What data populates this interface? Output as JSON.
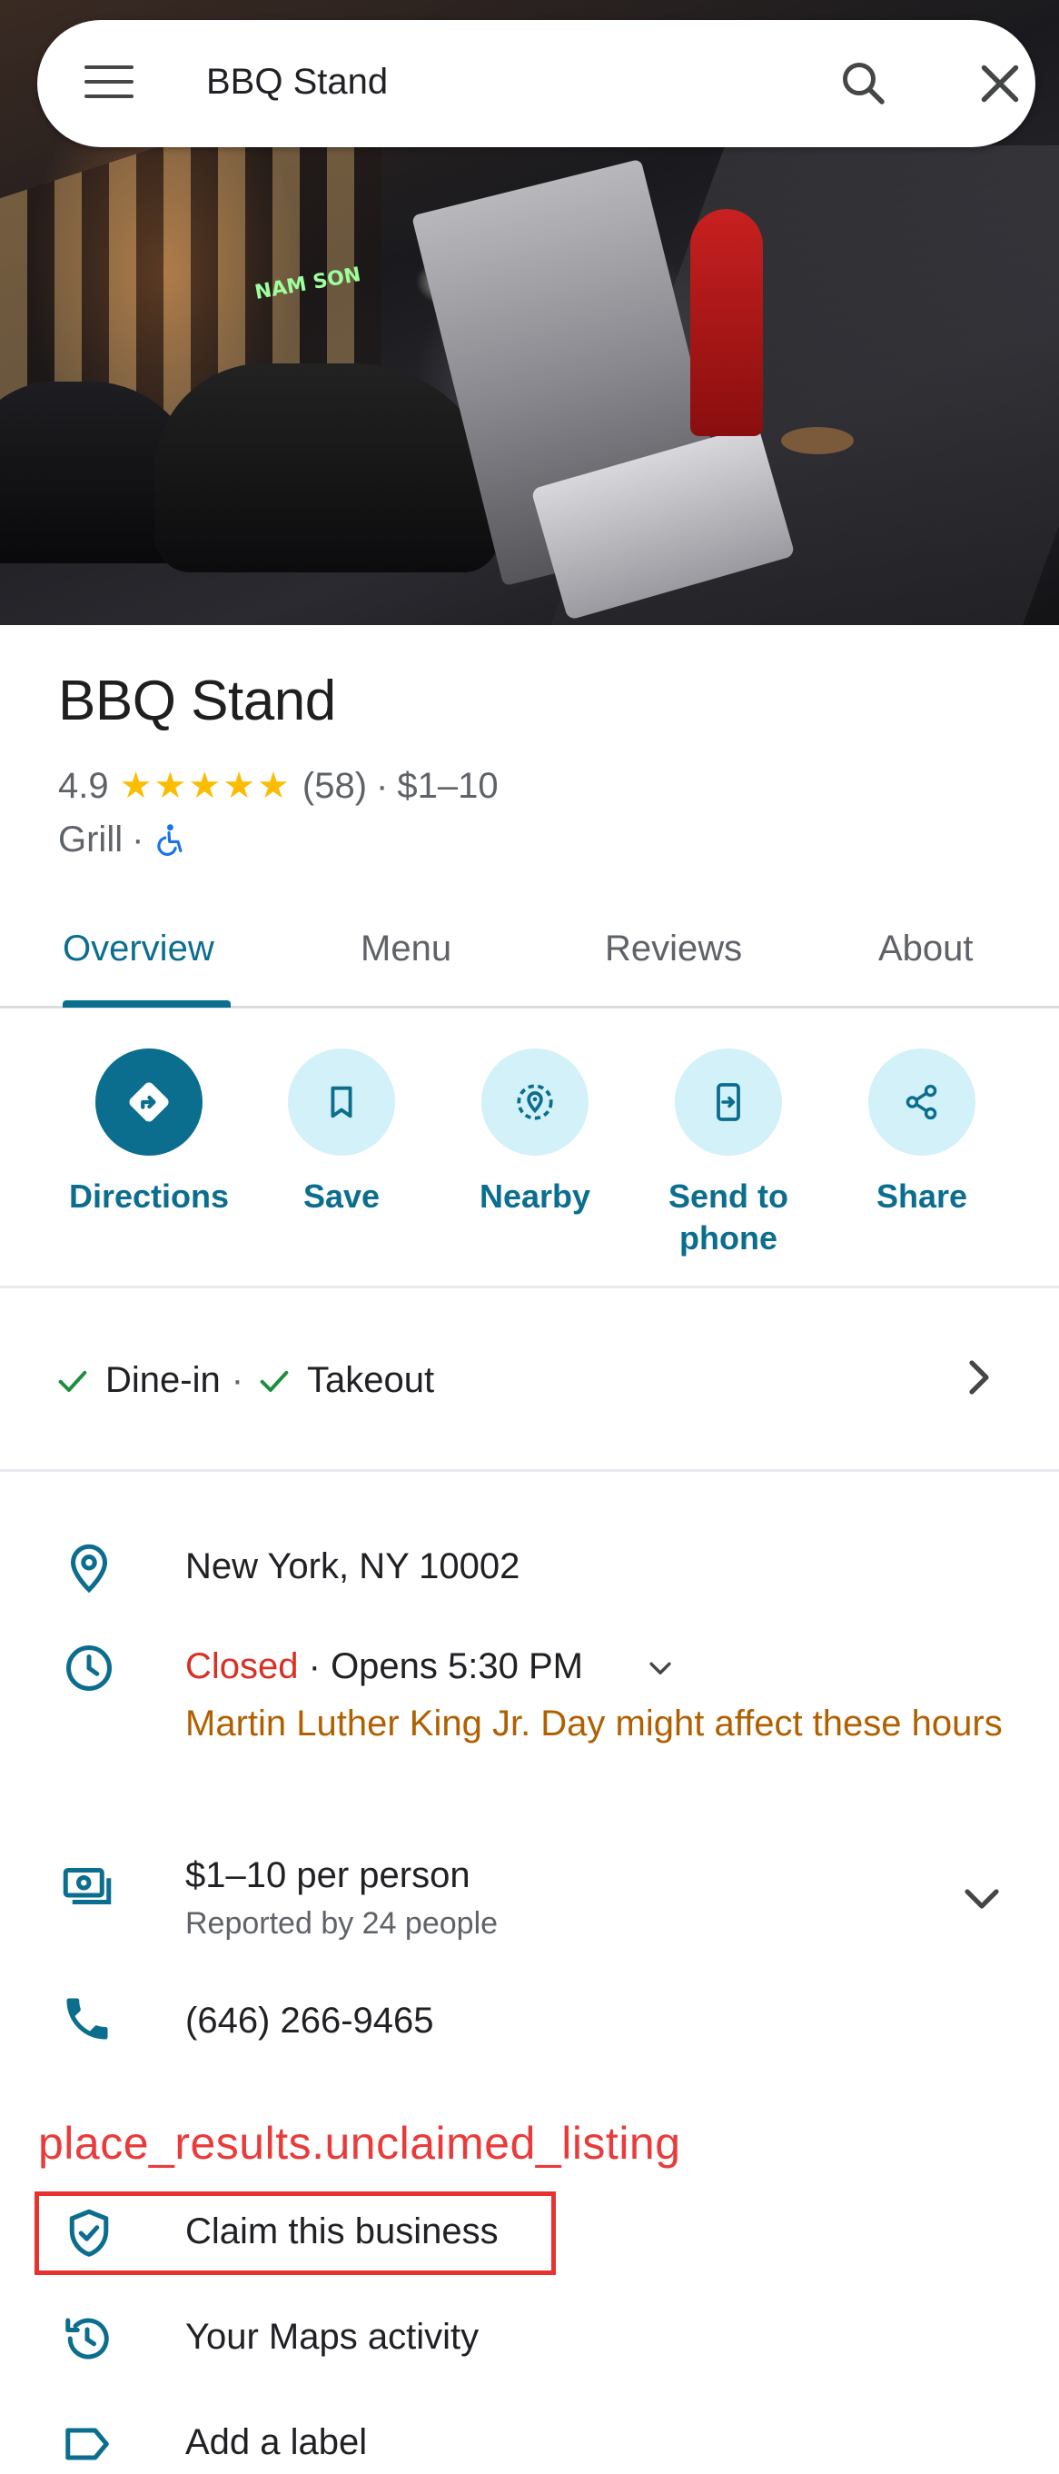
{
  "search": {
    "query": "BBQ Stand"
  },
  "hero": {
    "sign_text": "NAM SON"
  },
  "place": {
    "name": "BBQ Stand",
    "rating": "4.9",
    "stars": "★★★★★",
    "review_count": "(58)",
    "separator": "·",
    "price": "$1–10",
    "category": "Grill",
    "category_sep": "·"
  },
  "tabs": [
    {
      "label": "Overview",
      "active": true
    },
    {
      "label": "Menu",
      "active": false
    },
    {
      "label": "Reviews",
      "active": false
    },
    {
      "label": "About",
      "active": false
    }
  ],
  "actions": [
    {
      "label": "Directions",
      "icon": "directions-icon"
    },
    {
      "label": "Save",
      "icon": "bookmark-icon"
    },
    {
      "label": "Nearby",
      "icon": "nearby-icon"
    },
    {
      "label": "Send to\nphone",
      "line1": "Send to",
      "line2": "phone",
      "icon": "send-to-phone-icon"
    },
    {
      "label": "Share",
      "icon": "share-icon"
    }
  ],
  "amenities": {
    "items": [
      "Dine-in",
      "Takeout"
    ],
    "separator": "·"
  },
  "info": {
    "address": "New York, NY 10002",
    "status": "Closed",
    "opens": " · Opens 5:30 PM",
    "holiday_warning": "Martin Luther King Jr. Day might affect these hours",
    "price_per_person": "$1–10 per person",
    "price_reported": "Reported by 24 people",
    "phone": "(646) 266-9465"
  },
  "annotation": "place_results.unclaimed_listing",
  "extra": {
    "claim": "Claim this business",
    "activity": "Your Maps activity",
    "label": "Add a label"
  },
  "colors": {
    "accent": "#0b6e8e",
    "action_bg": "#d3f1f8",
    "closed": "#d93025",
    "warning": "#b06000",
    "stars": "#fbbc04",
    "annotation": "#ea3b3b"
  }
}
